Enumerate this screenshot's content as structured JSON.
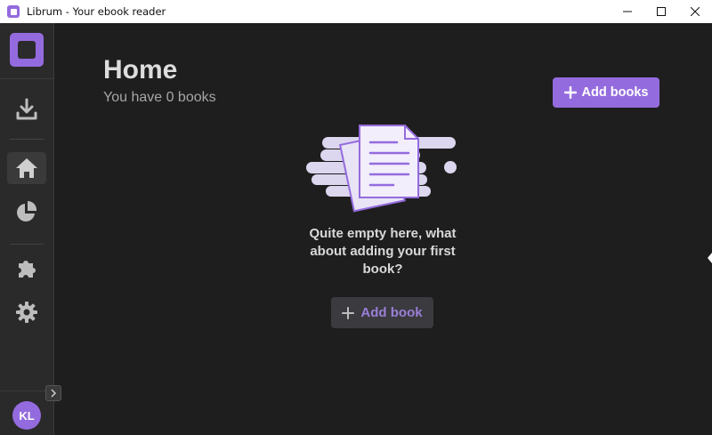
{
  "window": {
    "title": "Librum - Your ebook reader"
  },
  "sidebar": {
    "items": [
      {
        "icon": "download-icon"
      },
      {
        "icon": "home-icon",
        "active": true
      },
      {
        "icon": "statistics-icon"
      },
      {
        "icon": "plugins-icon"
      },
      {
        "icon": "settings-icon"
      }
    ],
    "avatar_initials": "KL"
  },
  "main": {
    "title": "Home",
    "subtitle": "You have 0 books",
    "add_books_label": "Add books",
    "empty_message": "Quite empty here, what about adding your first book?",
    "add_book_label": "Add book"
  },
  "colors": {
    "accent": "#946bde",
    "background": "#1e1e1e",
    "sidebar": "#2a2a2a"
  }
}
